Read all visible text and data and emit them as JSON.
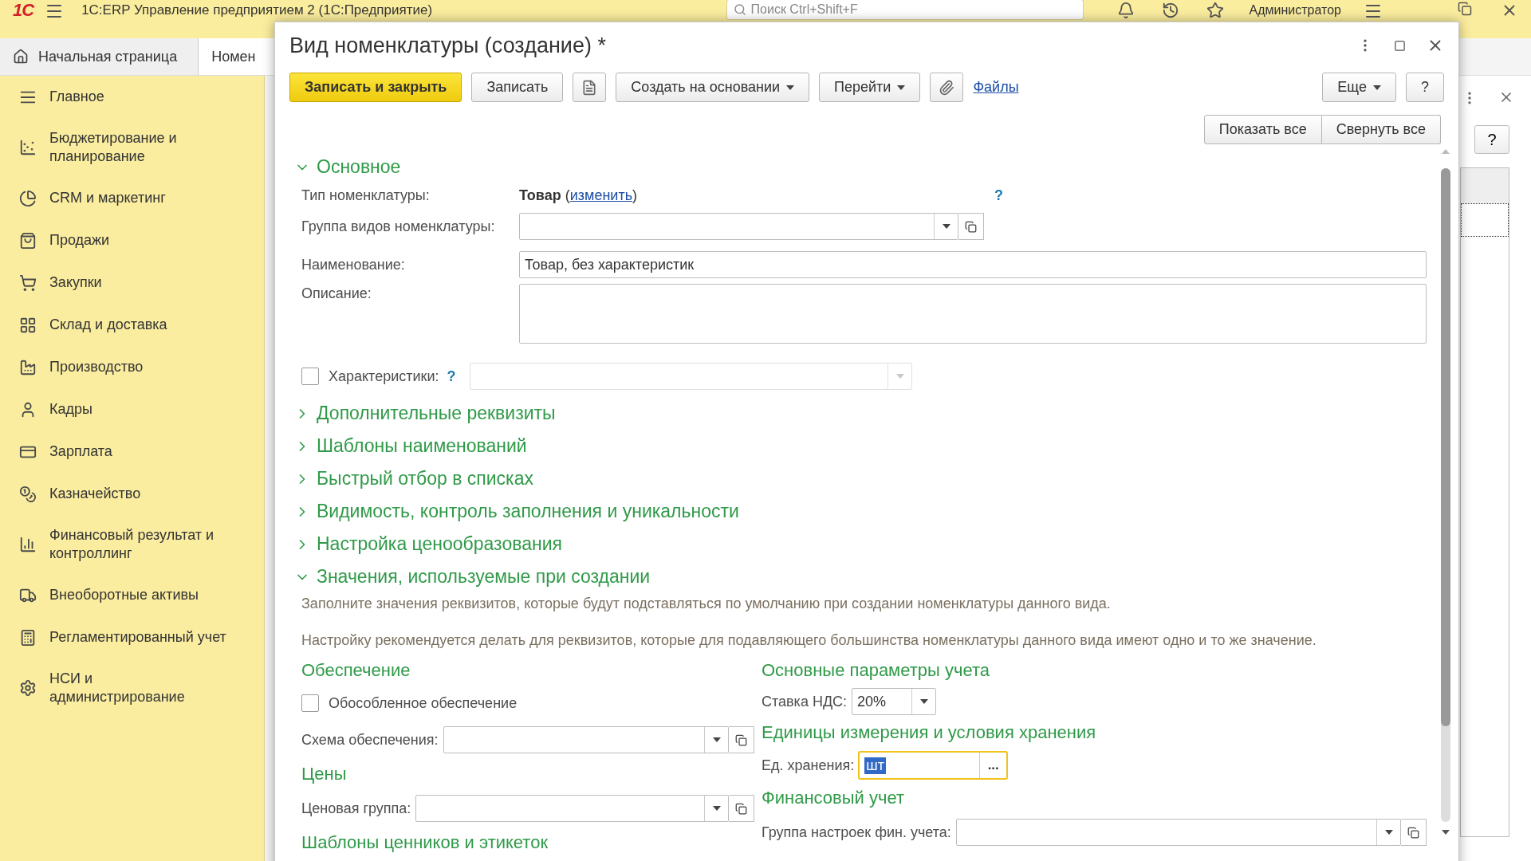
{
  "app_bar": {
    "logo": "1С",
    "title": "1С:ERP Управление предприятием 2  (1С:Предприятие)",
    "search": {
      "placeholder": "Поиск Ctrl+Shift+F"
    },
    "user": "Администратор"
  },
  "tabs": [
    {
      "label": "Начальная страница",
      "selected": false
    },
    {
      "label": "Номен",
      "selected": true
    }
  ],
  "sidebar": {
    "items": [
      {
        "label": "Главное"
      },
      {
        "label": "Бюджетирование и\nпланирование"
      },
      {
        "label": "CRM и маркетинг"
      },
      {
        "label": "Продажи"
      },
      {
        "label": "Закупки"
      },
      {
        "label": "Склад и доставка"
      },
      {
        "label": "Производство"
      },
      {
        "label": "Кадры"
      },
      {
        "label": "Зарплата"
      },
      {
        "label": "Казначейство"
      },
      {
        "label": "Финансовый результат и\nконтроллинг"
      },
      {
        "label": "Внеоборотные активы"
      },
      {
        "label": "Регламентированный учет"
      },
      {
        "label": "НСИ и\nадминистрирование"
      }
    ]
  },
  "background_form": {
    "help_button": "?"
  },
  "dialog": {
    "title": "Вид номенклатуры (создание) *",
    "toolbar": [
      {
        "kind": "primary",
        "label": "Записать и закрыть"
      },
      {
        "kind": "button",
        "label": "Записать"
      },
      {
        "kind": "list"
      },
      {
        "kind": "menu",
        "label": "Создать на основании"
      },
      {
        "kind": "menu",
        "label": "Перейти"
      },
      {
        "kind": "attach"
      },
      {
        "kind": "link",
        "label": "Файлы"
      },
      {
        "kind": "menu",
        "label": "Еще"
      },
      {
        "kind": "button",
        "label": "?"
      }
    ],
    "view_buttons": [
      "Показать все",
      "Свернуть все"
    ],
    "sections": [
      {
        "title": "Основное",
        "expanded": true,
        "content": {
          "kind": "main",
          "type_row": {
            "label": "Тип номенклатуры:",
            "value": "Товар",
            "before": "(",
            "link": "изменить",
            "after": ")",
            "help": "?"
          },
          "group_field": {
            "label": "Группа видов номенклатуры:"
          },
          "name_field": {
            "label": "Наименование:",
            "value": "Товар, без характеристик"
          },
          "description_field": {
            "label": "Описание:"
          },
          "characteristics": {
            "label": "Характеристики:",
            "checked": false,
            "help": "?",
            "disabled": true
          }
        }
      },
      {
        "title": "Дополнительные реквизиты",
        "expanded": false
      },
      {
        "title": "Шаблоны наименований",
        "expanded": false
      },
      {
        "title": "Быстрый отбор в списках",
        "expanded": false
      },
      {
        "title": "Видимость, контроль заполнения и уникальности",
        "expanded": false
      },
      {
        "title": "Настройка ценообразования",
        "expanded": false
      },
      {
        "title": "Значения, используемые при создании",
        "expanded": true,
        "content": {
          "kind": "defaults",
          "hints": [
            "Заполните значения реквизитов, которые будут подставляться по умолчанию при создании номенклатуры данного вида.",
            "Настройку рекомендуется делать для реквизитов, которые для подавляющего большинства номенклатуры данного вида имеют одно и то же значение."
          ],
          "columns": [
            [
              {
                "title": "Обеспечение",
                "rows": [
                  {
                    "kind": "checkbox",
                    "label": "Обособленное обеспечение",
                    "checked": false
                  },
                  {
                    "kind": "select",
                    "label": "Схема обеспечения:"
                  }
                ]
              },
              {
                "title": "Цены",
                "rows": [
                  {
                    "kind": "select",
                    "label": "Ценовая группа:"
                  }
                ]
              },
              {
                "title": "Шаблоны ценников и этикеток"
              }
            ],
            [
              {
                "title": "Основные параметры учета",
                "rows": [
                  {
                    "kind": "dropdown",
                    "label": "Ставка НДС:",
                    "value": "20%"
                  }
                ]
              },
              {
                "title": "Единицы измерения и условия хранения",
                "rows": [
                  {
                    "kind": "choice",
                    "label": "Ед. хранения:",
                    "value": "шт",
                    "focused": true,
                    "button": "..."
                  }
                ]
              },
              {
                "title": "Финансовый учет",
                "rows": [
                  {
                    "kind": "select",
                    "label": "Группа настроек фин. учета:"
                  }
                ]
              }
            ]
          ]
        }
      }
    ]
  }
}
